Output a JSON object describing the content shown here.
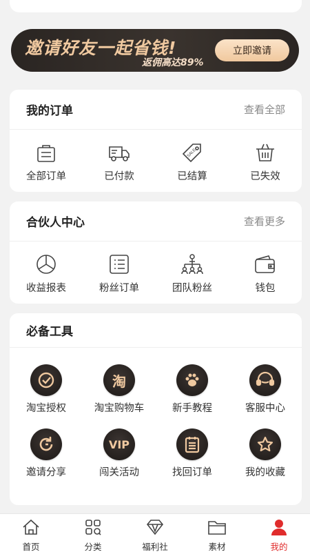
{
  "banner": {
    "title": "邀请好友一起省钱!",
    "subtitle": "返佣高达89%",
    "button": "立即邀请"
  },
  "orders": {
    "title": "我的订单",
    "more": "查看全部",
    "items": [
      {
        "label": "全部订单",
        "icon": "order-list-icon"
      },
      {
        "label": "已付款",
        "icon": "truck-icon"
      },
      {
        "label": "已结算",
        "icon": "sale-tag-icon"
      },
      {
        "label": "已失效",
        "icon": "basket-icon"
      }
    ]
  },
  "partner": {
    "title": "合伙人中心",
    "more": "查看更多",
    "items": [
      {
        "label": "收益报表",
        "icon": "pie-chart-icon"
      },
      {
        "label": "粉丝订单",
        "icon": "list-icon"
      },
      {
        "label": "团队粉丝",
        "icon": "team-icon"
      },
      {
        "label": "钱包",
        "icon": "wallet-icon"
      }
    ]
  },
  "tools": {
    "title": "必备工具",
    "items": [
      {
        "label": "淘宝授权",
        "icon": "check-circle-icon"
      },
      {
        "label": "淘宝购物车",
        "icon": "taobao-icon",
        "glyph": "淘"
      },
      {
        "label": "新手教程",
        "icon": "paw-icon"
      },
      {
        "label": "客服中心",
        "icon": "headset-icon"
      },
      {
        "label": "邀请分享",
        "icon": "refresh-icon"
      },
      {
        "label": "闯关活动",
        "icon": "vip-icon",
        "glyph": "VIP"
      },
      {
        "label": "找回订单",
        "icon": "clipboard-icon"
      },
      {
        "label": "我的收藏",
        "icon": "star-icon"
      }
    ]
  },
  "tabbar": {
    "items": [
      {
        "label": "首页",
        "icon": "home-icon"
      },
      {
        "label": "分类",
        "icon": "category-icon"
      },
      {
        "label": "福利社",
        "icon": "diamond-icon"
      },
      {
        "label": "素材",
        "icon": "folder-icon"
      },
      {
        "label": "我的",
        "icon": "user-icon",
        "active": true
      }
    ]
  },
  "colors": {
    "accent": "#e02c2c",
    "gold": "#f0c9a0",
    "dark": "#2a2522"
  }
}
